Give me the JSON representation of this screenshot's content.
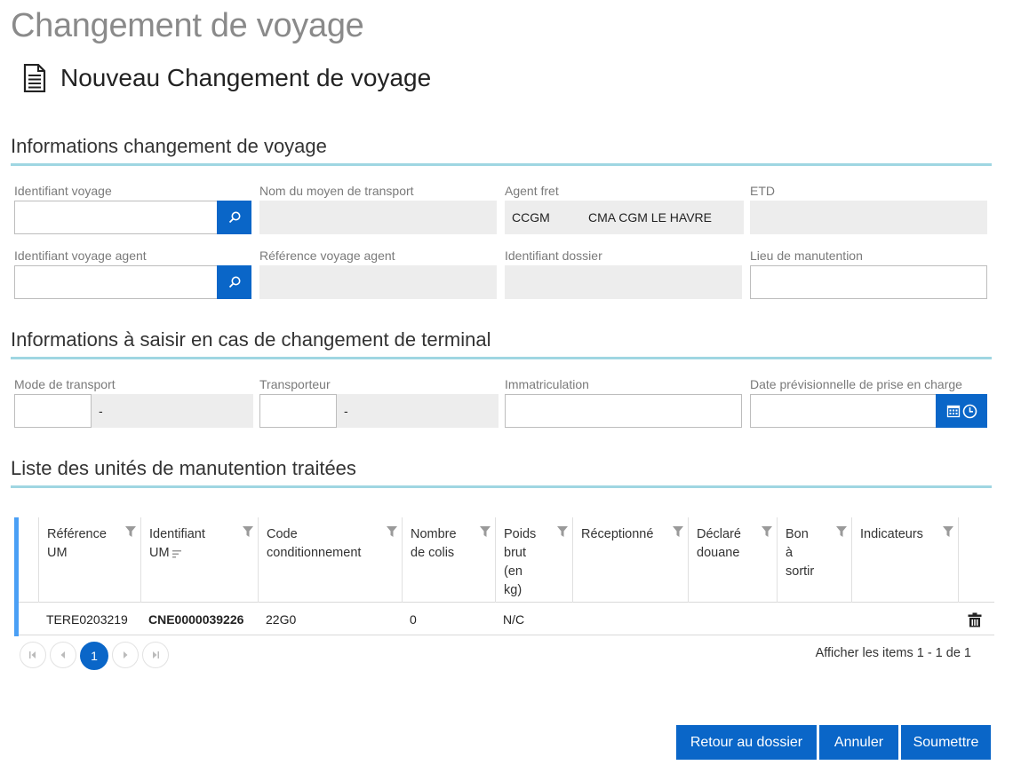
{
  "header": {
    "title": "Changement de voyage",
    "subtitle": "Nouveau Changement de voyage",
    "icon": "document-icon"
  },
  "section1": {
    "title": "Informations changement de voyage",
    "fields": {
      "identifiant_voyage": {
        "label": "Identifiant voyage",
        "value": ""
      },
      "nom_moyen_transport": {
        "label": "Nom du moyen de transport",
        "value": ""
      },
      "agent_fret": {
        "label": "Agent fret",
        "code": "CCGM",
        "name": "CMA CGM LE HAVRE"
      },
      "etd": {
        "label": "ETD",
        "value": ""
      },
      "identifiant_voyage_agent": {
        "label": "Identifiant voyage agent",
        "value": ""
      },
      "reference_voyage_agent": {
        "label": "Référence voyage agent",
        "value": ""
      },
      "identifiant_dossier": {
        "label": "Identifiant dossier",
        "value": ""
      },
      "lieu_manutention": {
        "label": "Lieu de manutention",
        "value": ""
      }
    }
  },
  "section2": {
    "title": "Informations à saisir en cas de changement de terminal",
    "fields": {
      "mode_transport": {
        "label": "Mode de transport",
        "value": "",
        "description": "-"
      },
      "transporteur": {
        "label": "Transporteur",
        "value": "",
        "description": "-"
      },
      "immatriculation": {
        "label": "Immatriculation",
        "value": ""
      },
      "date_prise_charge": {
        "label": "Date prévisionnelle de prise en charge",
        "value": ""
      }
    }
  },
  "section3": {
    "title": "Liste des unités de manutention traitées"
  },
  "grid": {
    "columns": [
      {
        "line1": "Référence",
        "line2": "UM",
        "line3": "",
        "line4": ""
      },
      {
        "line1": "Identifiant",
        "line2": "UM",
        "line3": "",
        "line4": ""
      },
      {
        "line1": "Code",
        "line2": "conditionnement",
        "line3": "",
        "line4": ""
      },
      {
        "line1": "Nombre",
        "line2": "de colis",
        "line3": "",
        "line4": ""
      },
      {
        "line1": "Poids",
        "line2": "brut",
        "line3": "(en",
        "line4": "kg)"
      },
      {
        "line1": "Réceptionné",
        "line2": "",
        "line3": "",
        "line4": ""
      },
      {
        "line1": "Déclaré",
        "line2": "douane",
        "line3": "",
        "line4": ""
      },
      {
        "line1": "Bon",
        "line2": "à",
        "line3": "sortir",
        "line4": ""
      },
      {
        "line1": "Indicateurs",
        "line2": "",
        "line3": "",
        "line4": ""
      }
    ],
    "rows": [
      {
        "reference_um": "TERE0203219",
        "identifiant_um": "CNE0000039226",
        "code_conditionnement": "22G0",
        "nombre_colis": "0",
        "poids_brut": "N/C",
        "receptionne": "",
        "declare_douane": "",
        "bon_a_sortir": "",
        "indicateurs": ""
      }
    ],
    "pager": {
      "current_page": "1",
      "info": "Afficher les items 1 - 1 de 1"
    }
  },
  "actions": {
    "retour": "Retour au dossier",
    "annuler": "Annuler",
    "soumettre": "Soumettre"
  },
  "colors": {
    "primary": "#0a66c8",
    "section_rule": "#9fd6e2",
    "grid_accent": "#4a9ff5",
    "readonly_bg": "#ededed"
  }
}
